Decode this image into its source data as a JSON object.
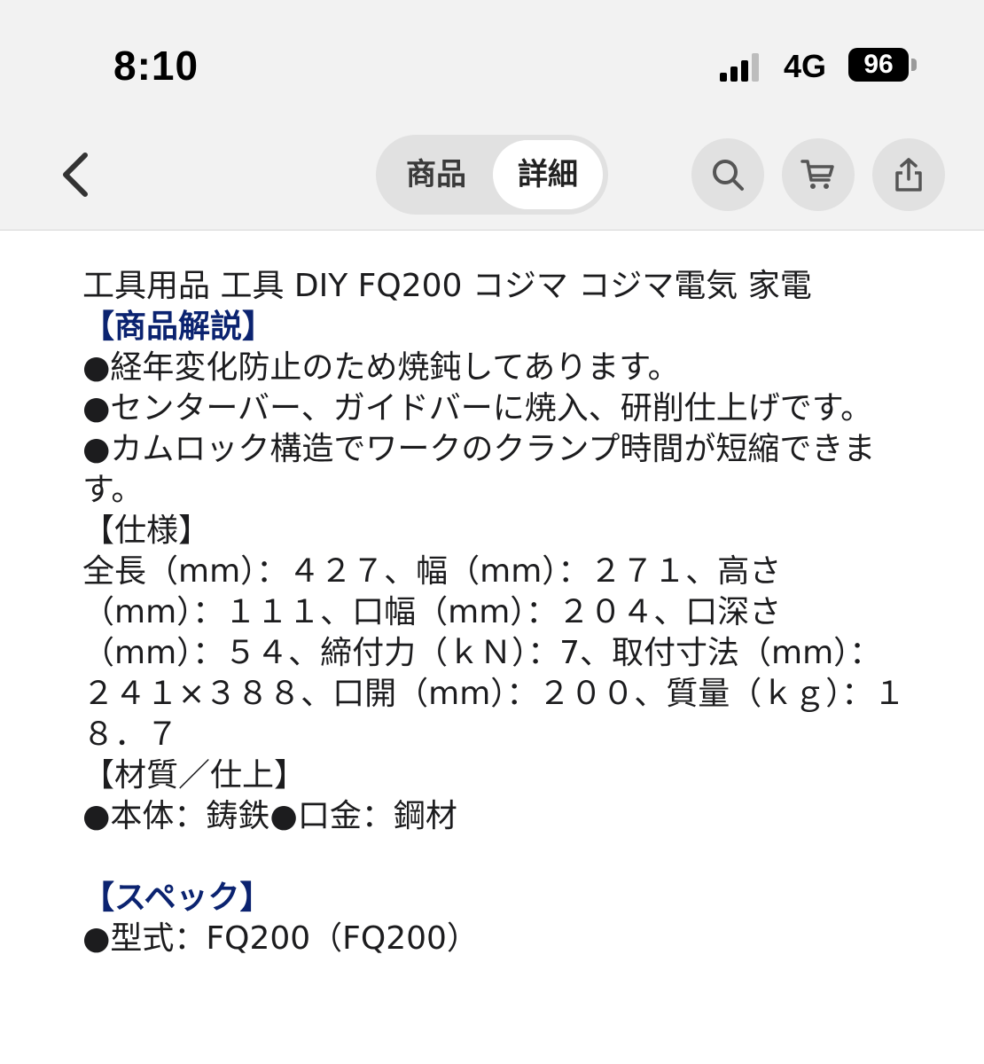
{
  "status_bar": {
    "time": "8:10",
    "network": "4G",
    "battery": "96"
  },
  "header": {
    "tabs": [
      {
        "label": "商品",
        "selected": false
      },
      {
        "label": "詳細",
        "selected": true
      }
    ],
    "icons": [
      "back-chevron-icon",
      "search-icon",
      "cart-icon",
      "share-icon"
    ]
  },
  "description": {
    "keywords": "工具用品 工具 DIY FQ200 コジマ コジマ電気 家電",
    "section1_heading": "【商品解説】",
    "bullets": [
      "●経年変化防止のため焼鈍してあります。",
      "●センターバー、ガイドバーに焼入、研削仕上げです。",
      "●カムロック構造でワークのクランプ時間が短縮できます。"
    ],
    "spec_heading": "【仕様】",
    "spec_text": "全長（mm）：４２７、幅（mm）：２７１、高さ（mm）：１１１、口幅（mm）：２０４、口深さ（mm）：５４、締付力（ｋＮ）：7、取付寸法（mm）：２４１×３８８、口開（mm）：２００、質量（ｋｇ）：１８．７",
    "material_heading": "【材質／仕上】",
    "material_text": "●本体：鋳鉄●口金：鋼材",
    "section2_heading": "【スペック】",
    "model": "●型式：FQ200（FQ200）"
  },
  "colors": {
    "heading": "#0b2370",
    "topbar_bg": "#f2f2f2",
    "button_bg": "#e1e1e1"
  }
}
